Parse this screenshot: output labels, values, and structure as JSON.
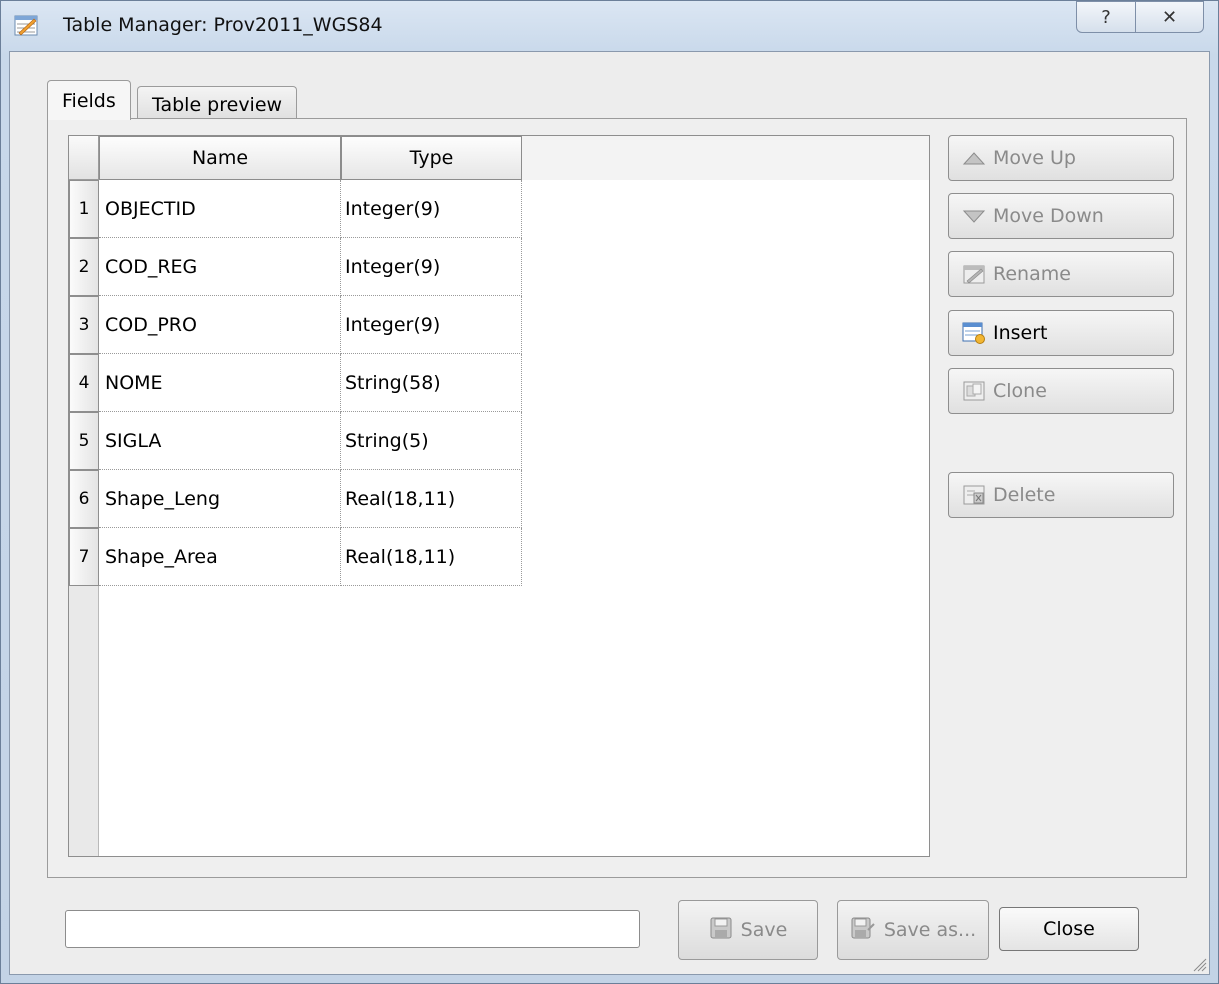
{
  "window": {
    "title": "Table Manager: Prov2011_WGS84",
    "help_label": "?",
    "close_label": "✕"
  },
  "tabs": [
    {
      "label": "Fields",
      "active": true
    },
    {
      "label": "Table preview",
      "active": false
    }
  ],
  "table": {
    "columns": [
      "Name",
      "Type"
    ],
    "rows": [
      {
        "num": "1",
        "name": "OBJECTID",
        "type": "Integer(9)"
      },
      {
        "num": "2",
        "name": "COD_REG",
        "type": "Integer(9)"
      },
      {
        "num": "3",
        "name": "COD_PRO",
        "type": "Integer(9)"
      },
      {
        "num": "4",
        "name": "NOME",
        "type": "String(58)"
      },
      {
        "num": "5",
        "name": "SIGLA",
        "type": "String(5)"
      },
      {
        "num": "6",
        "name": "Shape_Leng",
        "type": "Real(18,11)"
      },
      {
        "num": "7",
        "name": "Shape_Area",
        "type": "Real(18,11)"
      }
    ]
  },
  "side_buttons": {
    "move_up": "Move Up",
    "move_down": "Move Down",
    "rename": "Rename",
    "insert": "Insert",
    "clone": "Clone",
    "delete": "Delete"
  },
  "bottom": {
    "status_value": "",
    "save": "Save",
    "save_as": "Save as...",
    "close": "Close"
  },
  "colors": {
    "titlebar": "#c8d8ea",
    "client_bg": "#ededed",
    "disabled_text": "#8a8a8a"
  }
}
